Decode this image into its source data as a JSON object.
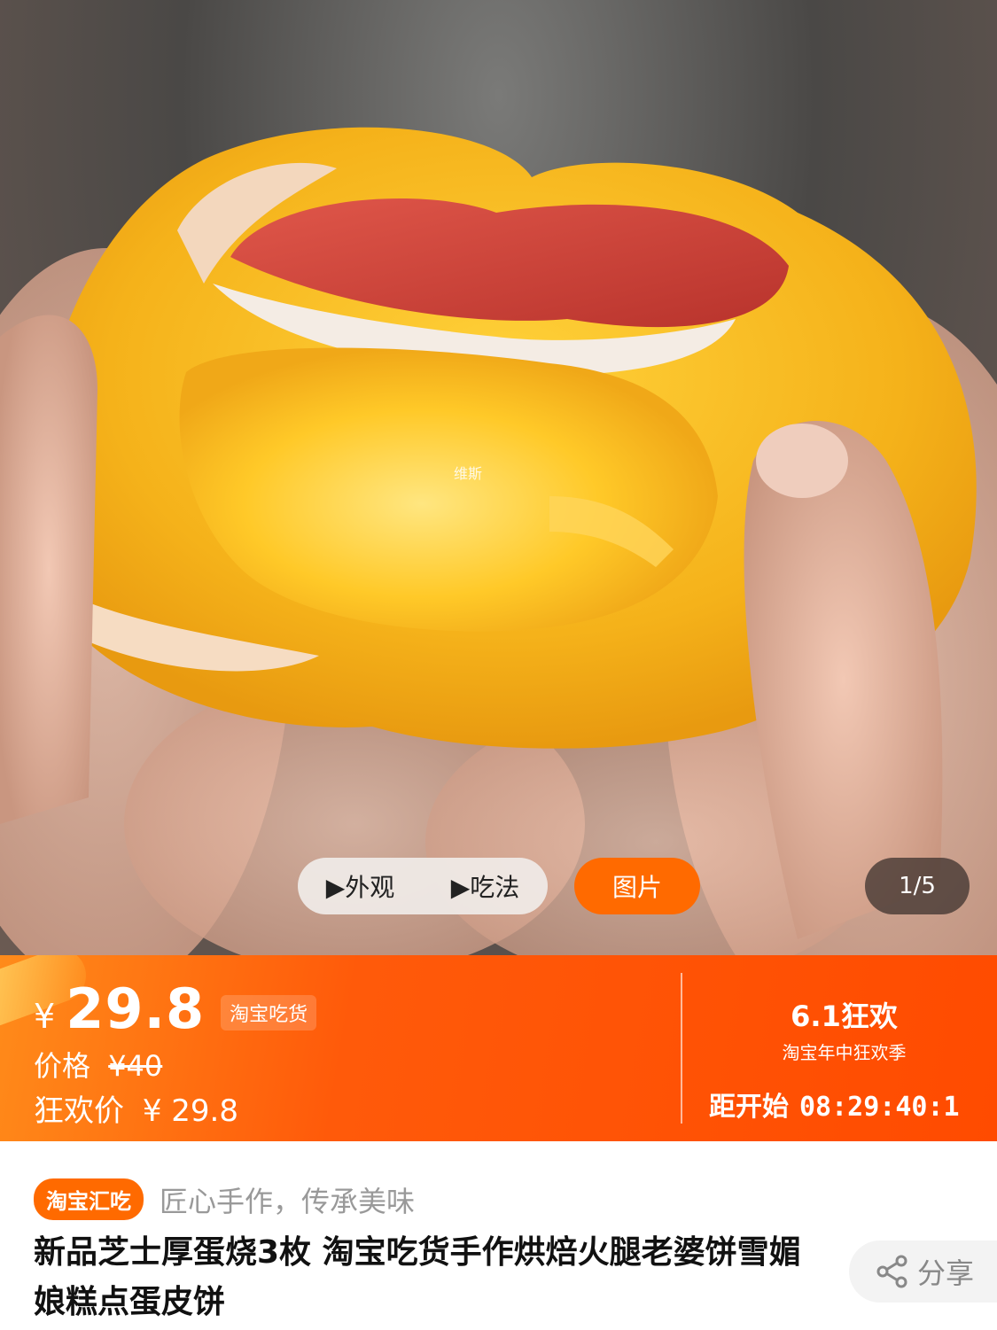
{
  "media": {
    "video_tabs": [
      {
        "icon": "play-icon",
        "label": "▶外观"
      },
      {
        "icon": "play-icon",
        "label": "▶吃法"
      }
    ],
    "picture_tab": "图片",
    "counter": "1/5",
    "watermark": "维斯"
  },
  "price": {
    "currency": "¥",
    "current": "29.8",
    "store_tag": "淘宝吃货",
    "original_label": "价格",
    "original_value": "¥40",
    "carnival_label": "狂欢价",
    "carnival_value": "¥ 29.8"
  },
  "event": {
    "title": "6.1狂欢",
    "subtitle": "淘宝年中狂欢季",
    "countdown_label": "距开始",
    "countdown_time": "08:29:40:1"
  },
  "product": {
    "badge": "淘宝汇吃",
    "slogan": "匠心手作，传承美味",
    "title": "新品芝士厚蛋烧3枚 淘宝吃货手作烘焙火腿老婆饼雪媚娘糕点蛋皮饼",
    "share_label": "分享"
  },
  "colors": {
    "accent": "#ff6a00",
    "banner_start": "#ff8b1a",
    "banner_end": "#ff4b00"
  }
}
